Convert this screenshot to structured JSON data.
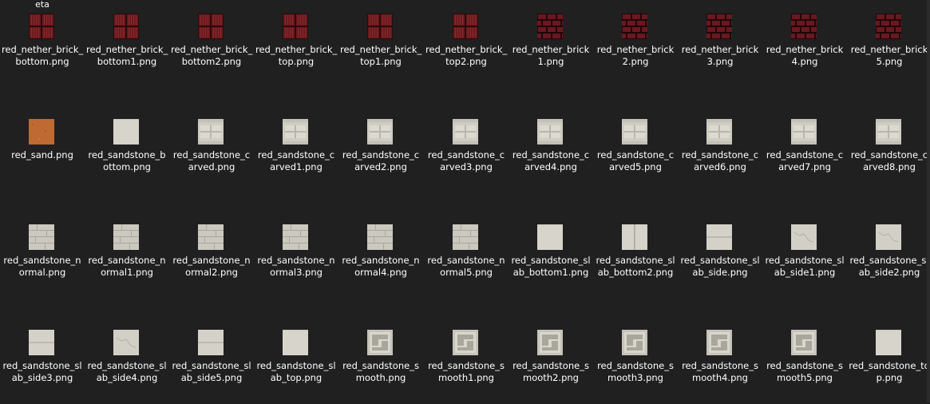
{
  "partial_label": "eta",
  "colors": {
    "background": "#202020",
    "text": "#ffffff"
  },
  "files": [
    {
      "name": "red_nether_brick_\nbottom.png",
      "icon": "nether-brick-grid-icon"
    },
    {
      "name": "red_nether_brick_\nbottom1.png",
      "icon": "nether-brick-grid-icon"
    },
    {
      "name": "red_nether_brick_\nbottom2.png",
      "icon": "nether-brick-grid-icon"
    },
    {
      "name": "red_nether_brick_\ntop.png",
      "icon": "nether-brick-grid-icon"
    },
    {
      "name": "red_nether_brick_\ntop1.png",
      "icon": "nether-brick-grid-icon"
    },
    {
      "name": "red_nether_brick_\ntop2.png",
      "icon": "nether-brick-grid-icon"
    },
    {
      "name": "red_nether_brick\n1.png",
      "icon": "nether-brick-wall-icon"
    },
    {
      "name": "red_nether_brick\n2.png",
      "icon": "nether-brick-wall-icon"
    },
    {
      "name": "red_nether_brick\n3.png",
      "icon": "nether-brick-wall-icon"
    },
    {
      "name": "red_nether_brick\n4.png",
      "icon": "nether-brick-wall-icon"
    },
    {
      "name": "red_nether_brick\n5.png",
      "icon": "nether-brick-wall-icon"
    },
    {
      "name": "red_sand.png",
      "icon": "red-sand-icon"
    },
    {
      "name": "red_sandstone_b\nottom.png",
      "icon": "sandstone-plain-icon"
    },
    {
      "name": "red_sandstone_c\narved.png",
      "icon": "sandstone-carved-icon"
    },
    {
      "name": "red_sandstone_c\narved1.png",
      "icon": "sandstone-carved-icon"
    },
    {
      "name": "red_sandstone_c\narved2.png",
      "icon": "sandstone-carved-icon"
    },
    {
      "name": "red_sandstone_c\narved3.png",
      "icon": "sandstone-carved-icon"
    },
    {
      "name": "red_sandstone_c\narved4.png",
      "icon": "sandstone-carved-icon"
    },
    {
      "name": "red_sandstone_c\narved5.png",
      "icon": "sandstone-carved-icon"
    },
    {
      "name": "red_sandstone_c\narved6.png",
      "icon": "sandstone-carved-icon"
    },
    {
      "name": "red_sandstone_c\narved7.png",
      "icon": "sandstone-carved-icon"
    },
    {
      "name": "red_sandstone_c\narved8.png",
      "icon": "sandstone-carved-icon"
    },
    {
      "name": "red_sandstone_n\normal.png",
      "icon": "sandstone-brick-icon"
    },
    {
      "name": "red_sandstone_n\normal1.png",
      "icon": "sandstone-brick-icon"
    },
    {
      "name": "red_sandstone_n\normal2.png",
      "icon": "sandstone-brick-icon"
    },
    {
      "name": "red_sandstone_n\normal3.png",
      "icon": "sandstone-brick-icon"
    },
    {
      "name": "red_sandstone_n\normal4.png",
      "icon": "sandstone-brick-icon"
    },
    {
      "name": "red_sandstone_n\normal5.png",
      "icon": "sandstone-brick-icon"
    },
    {
      "name": "red_sandstone_sl\nab_bottom1.png",
      "icon": "sandstone-plain-icon"
    },
    {
      "name": "red_sandstone_sl\nab_bottom2.png",
      "icon": "sandstone-split-icon"
    },
    {
      "name": "red_sandstone_sl\nab_side.png",
      "icon": "sandstone-slab-icon"
    },
    {
      "name": "red_sandstone_sl\nab_side1.png",
      "icon": "sandstone-cracked-icon"
    },
    {
      "name": "red_sandstone_sl\nab_side2.png",
      "icon": "sandstone-cracked-icon"
    },
    {
      "name": "red_sandstone_sl\nab_side3.png",
      "icon": "sandstone-slab-icon"
    },
    {
      "name": "red_sandstone_sl\nab_side4.png",
      "icon": "sandstone-cracked-icon"
    },
    {
      "name": "red_sandstone_sl\nab_side5.png",
      "icon": "sandstone-slab-icon"
    },
    {
      "name": "red_sandstone_sl\nab_top.png",
      "icon": "sandstone-plain-icon"
    },
    {
      "name": "red_sandstone_s\nmooth.png",
      "icon": "sandstone-smooth-icon"
    },
    {
      "name": "red_sandstone_s\nmooth1.png",
      "icon": "sandstone-smooth-icon"
    },
    {
      "name": "red_sandstone_s\nmooth2.png",
      "icon": "sandstone-smooth-icon"
    },
    {
      "name": "red_sandstone_s\nmooth3.png",
      "icon": "sandstone-smooth-icon"
    },
    {
      "name": "red_sandstone_s\nmooth4.png",
      "icon": "sandstone-smooth-icon"
    },
    {
      "name": "red_sandstone_s\nmooth5.png",
      "icon": "sandstone-smooth-icon"
    },
    {
      "name": "red_sandstone_to\np.png",
      "icon": "sandstone-plain-icon"
    }
  ]
}
